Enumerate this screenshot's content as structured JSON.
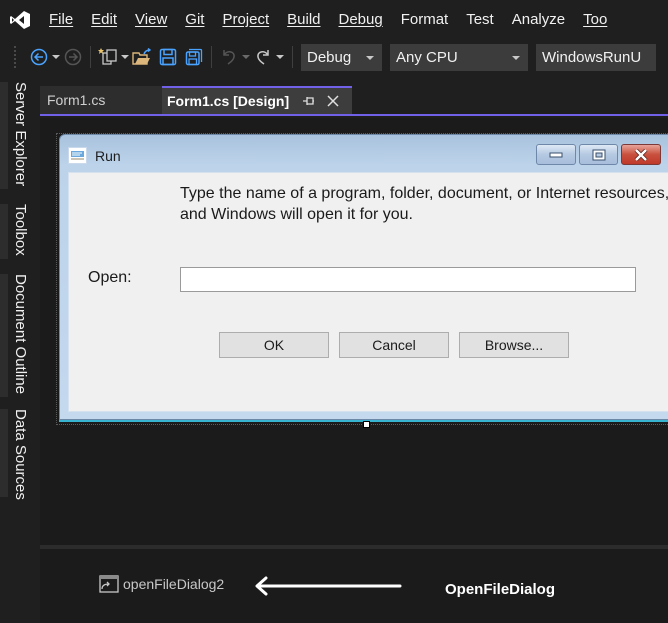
{
  "menubar": {
    "logo": "visual-studio-logo",
    "items": [
      {
        "label": "File",
        "mnemonic_index": 0
      },
      {
        "label": "Edit",
        "mnemonic_index": 0
      },
      {
        "label": "View",
        "mnemonic_index": 0
      },
      {
        "label": "Git",
        "mnemonic_index": 0
      },
      {
        "label": "Project",
        "mnemonic_index": 0
      },
      {
        "label": "Build",
        "mnemonic_index": 0
      },
      {
        "label": "Debug",
        "mnemonic_index": 0
      },
      {
        "label": "Format",
        "mnemonic_index": 1
      },
      {
        "label": "Test",
        "mnemonic_index": 2
      },
      {
        "label": "Analyze",
        "mnemonic_index": 1
      },
      {
        "label": "Too",
        "mnemonic_index": 0
      }
    ]
  },
  "toolbar": {
    "icons": [
      "navigate-back-icon",
      "navigate-forward-icon",
      "new-project-icon",
      "open-file-icon",
      "save-icon",
      "save-all-icon",
      "undo-icon",
      "redo-icon"
    ],
    "configuration": "Debug",
    "platform": "Any CPU",
    "startup_project": "WindowsRunU"
  },
  "side_tabs": [
    "Server Explorer",
    "Toolbox",
    "Document Outline",
    "Data Sources"
  ],
  "doc_tabs": [
    {
      "label": "Form1.cs",
      "active": false
    },
    {
      "label": "Form1.cs [Design]",
      "active": true
    }
  ],
  "run_dialog": {
    "title": "Run",
    "description": "Type the name of a program, folder, document, or Internet resources, and Windows will open it for you.",
    "open_label": "Open:",
    "open_value": "",
    "buttons": {
      "ok": "OK",
      "cancel": "Cancel",
      "browse": "Browse..."
    }
  },
  "component_tray": {
    "items": [
      {
        "label": "openFileDialog2",
        "icon": "open-file-dialog-icon"
      }
    ]
  },
  "annotation": {
    "label": "OpenFileDialog"
  },
  "colors": {
    "accent": "#7160e8",
    "ide_background": "#1f1f1f",
    "dialog_client": "#f0f0f0",
    "close_button": "#c9503e"
  }
}
